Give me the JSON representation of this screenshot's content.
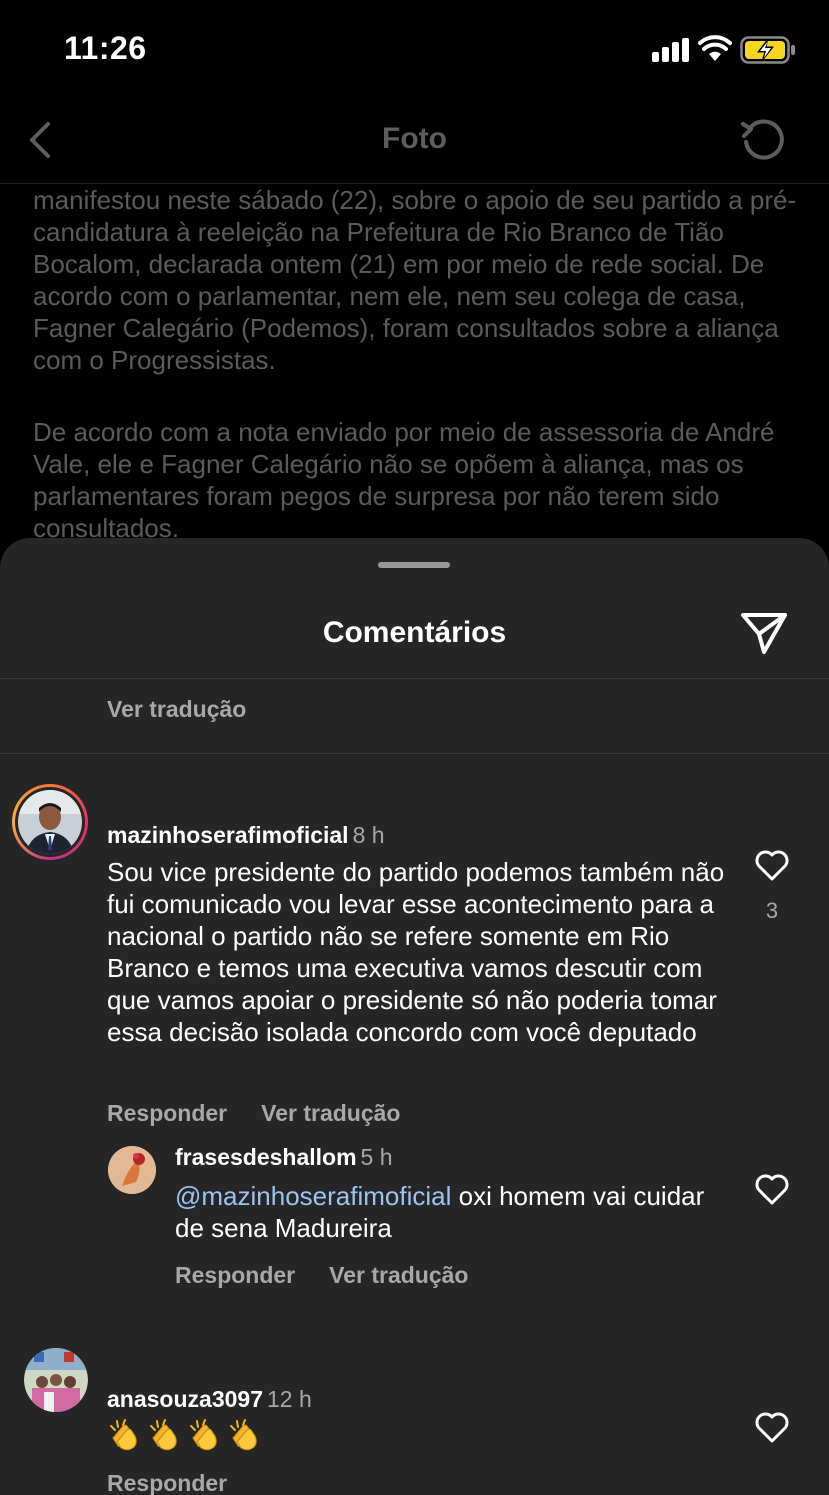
{
  "status": {
    "time": "11:26"
  },
  "header": {
    "title": "Foto",
    "back_icon": "chevron-left-icon",
    "refresh_icon": "refresh-icon"
  },
  "caption": {
    "paragraphs": [
      "manifestou neste sábado (22), sobre o apoio de seu partido a pré-candidatura à reeleição na Prefeitura de Rio Branco de Tião Bocalom, declarada ontem (21) em por meio de rede social. De acordo com o parlamentar, nem ele, nem seu colega de casa, Fagner Calegário (Podemos), foram consultados sobre a aliança com o Progressistas.",
      "De acordo com a nota enviado por meio de assessoria de André Vale, ele e Fagner Calegário não se opõem à aliança, mas os parlamentares foram pegos de surpresa por não terem sido consultados."
    ]
  },
  "sheet": {
    "title": "Comentários",
    "share_icon": "paper-plane-icon",
    "top_translate": "Ver tradução"
  },
  "comments": [
    {
      "username": "mazinhoserafimoficial",
      "time": "8 h",
      "text": "Sou vice presidente do partido podemos também não fui comunicado vou levar esse acontecimento para a nacional o partido não se refere somente em Rio Branco e temos uma executiva vamos descutir com que vamos apoiar o presidente só não poderia tomar essa decisão isolada concordo com você deputado",
      "likes": "3",
      "reply_label": "Responder",
      "translate_label": "Ver tradução"
    },
    {
      "username": "frasesdeshallom",
      "time": "5 h",
      "mention": "@mazinhoserafimoficial",
      "text": " oxi homem vai cuidar de sena Madureira",
      "reply_label": "Responder",
      "translate_label": "Ver tradução"
    },
    {
      "username": "anasouza3097",
      "time": "12 h",
      "emoji_count": 4,
      "emoji_icon": "clapping-hands-icon",
      "reply_label": "Responder"
    }
  ],
  "colors": {
    "background": "#000000",
    "sheet": "#262626",
    "muted_text": "#a8a8a8",
    "mention": "#9ec3f0",
    "battery_charging": "#f5d623"
  }
}
